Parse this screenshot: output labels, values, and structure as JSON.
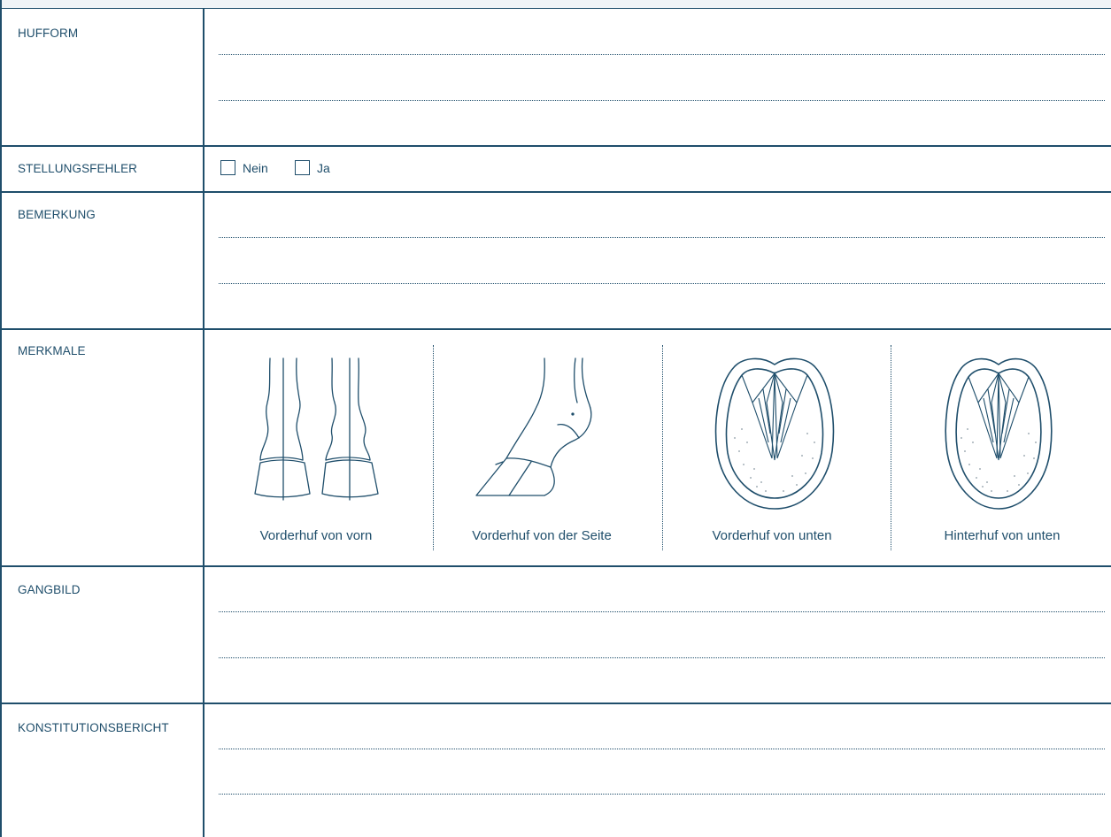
{
  "rows": [
    {
      "key": "hufform",
      "label": "HUFFORM"
    },
    {
      "key": "stellungsfehler",
      "label": "STELLUNGSFEHLER"
    },
    {
      "key": "bemerkung",
      "label": "BEMERKUNG"
    },
    {
      "key": "merkmale",
      "label": "MERKMALE"
    },
    {
      "key": "gangbild",
      "label": "GANGBILD"
    },
    {
      "key": "konstitutionsbericht",
      "label": "KONSTITUTIONSBERICHT"
    }
  ],
  "stellungsfehler_options": [
    {
      "label": "Nein",
      "checked": false
    },
    {
      "label": "Ja",
      "checked": false
    }
  ],
  "merkmale_images": [
    {
      "caption": "Vorderhuf von vorn",
      "icon": "hoof-front-view-icon"
    },
    {
      "caption": "Vorderhuf von der Seite",
      "icon": "hoof-side-view-icon"
    },
    {
      "caption": "Vorderhuf von unten",
      "icon": "front-hoof-sole-icon"
    },
    {
      "caption": "Hinterhuf von unten",
      "icon": "hind-hoof-sole-icon"
    }
  ],
  "colors": {
    "ink": "#1f4e6b",
    "header_strip": "#f0f4f7",
    "background": "#ffffff"
  }
}
